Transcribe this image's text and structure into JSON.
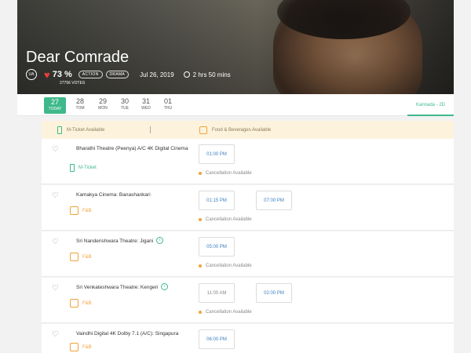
{
  "movie": {
    "title": "Dear Comrade",
    "certificate": "UA",
    "rating": "73 %",
    "votes": "27756 VOTES",
    "genres": [
      "ACTION",
      "DRAMA"
    ],
    "release_date": "Jul 26, 2019",
    "duration": "2 hrs 50 mins"
  },
  "dates": [
    {
      "num": "27",
      "day": "TODAY",
      "active": true
    },
    {
      "num": "28",
      "day": "TOM",
      "active": false
    },
    {
      "num": "29",
      "day": "MON",
      "active": false
    },
    {
      "num": "30",
      "day": "TUE",
      "active": false
    },
    {
      "num": "31",
      "day": "WED",
      "active": false
    },
    {
      "num": "01",
      "day": "THU",
      "active": false
    }
  ],
  "language": "Kannada - 2D",
  "legend": {
    "mticket": "M-Ticket Available",
    "food": "Food & Beverages Available"
  },
  "theatres": [
    {
      "name": "Bharathi Theatre (Peenya) A/C 4K Digital Cinema",
      "amenity": "M-Ticket",
      "amenity_type": "mticket",
      "info": false,
      "shows": [
        "01:00 PM"
      ],
      "cancellation": "Cancellation Available"
    },
    {
      "name": "Kamakya Cinema: Banashankari",
      "amenity": "F&B",
      "amenity_type": "fb",
      "info": false,
      "shows": [
        "01:15 PM",
        "07:00 PM"
      ],
      "cancellation": "Cancellation Available"
    },
    {
      "name": "Sri Nanderishwara Theatre: Jigani",
      "amenity": "F&B",
      "amenity_type": "fb",
      "info": true,
      "shows": [
        "05:00 PM"
      ],
      "cancellation": "Cancellation Available"
    },
    {
      "name": "Sri Venkateshwara Theatre: Kengeri",
      "amenity": "F&B",
      "amenity_type": "fb",
      "info": true,
      "shows": [
        "11:00 AM",
        "02:00 PM"
      ],
      "cancellation": "Cancellation Available"
    },
    {
      "name": "Vaindhi Digital 4K Dolby 7.1 (A/C): Singapura",
      "amenity": "F&B",
      "amenity_type": "fb",
      "info": false,
      "shows": [
        "06:00 PM"
      ],
      "cancellation": ""
    }
  ],
  "colors": {
    "accent": "#3fb98b",
    "food": "#f0a33a",
    "heart": "#e8403a",
    "time": "#3b7fbf"
  }
}
